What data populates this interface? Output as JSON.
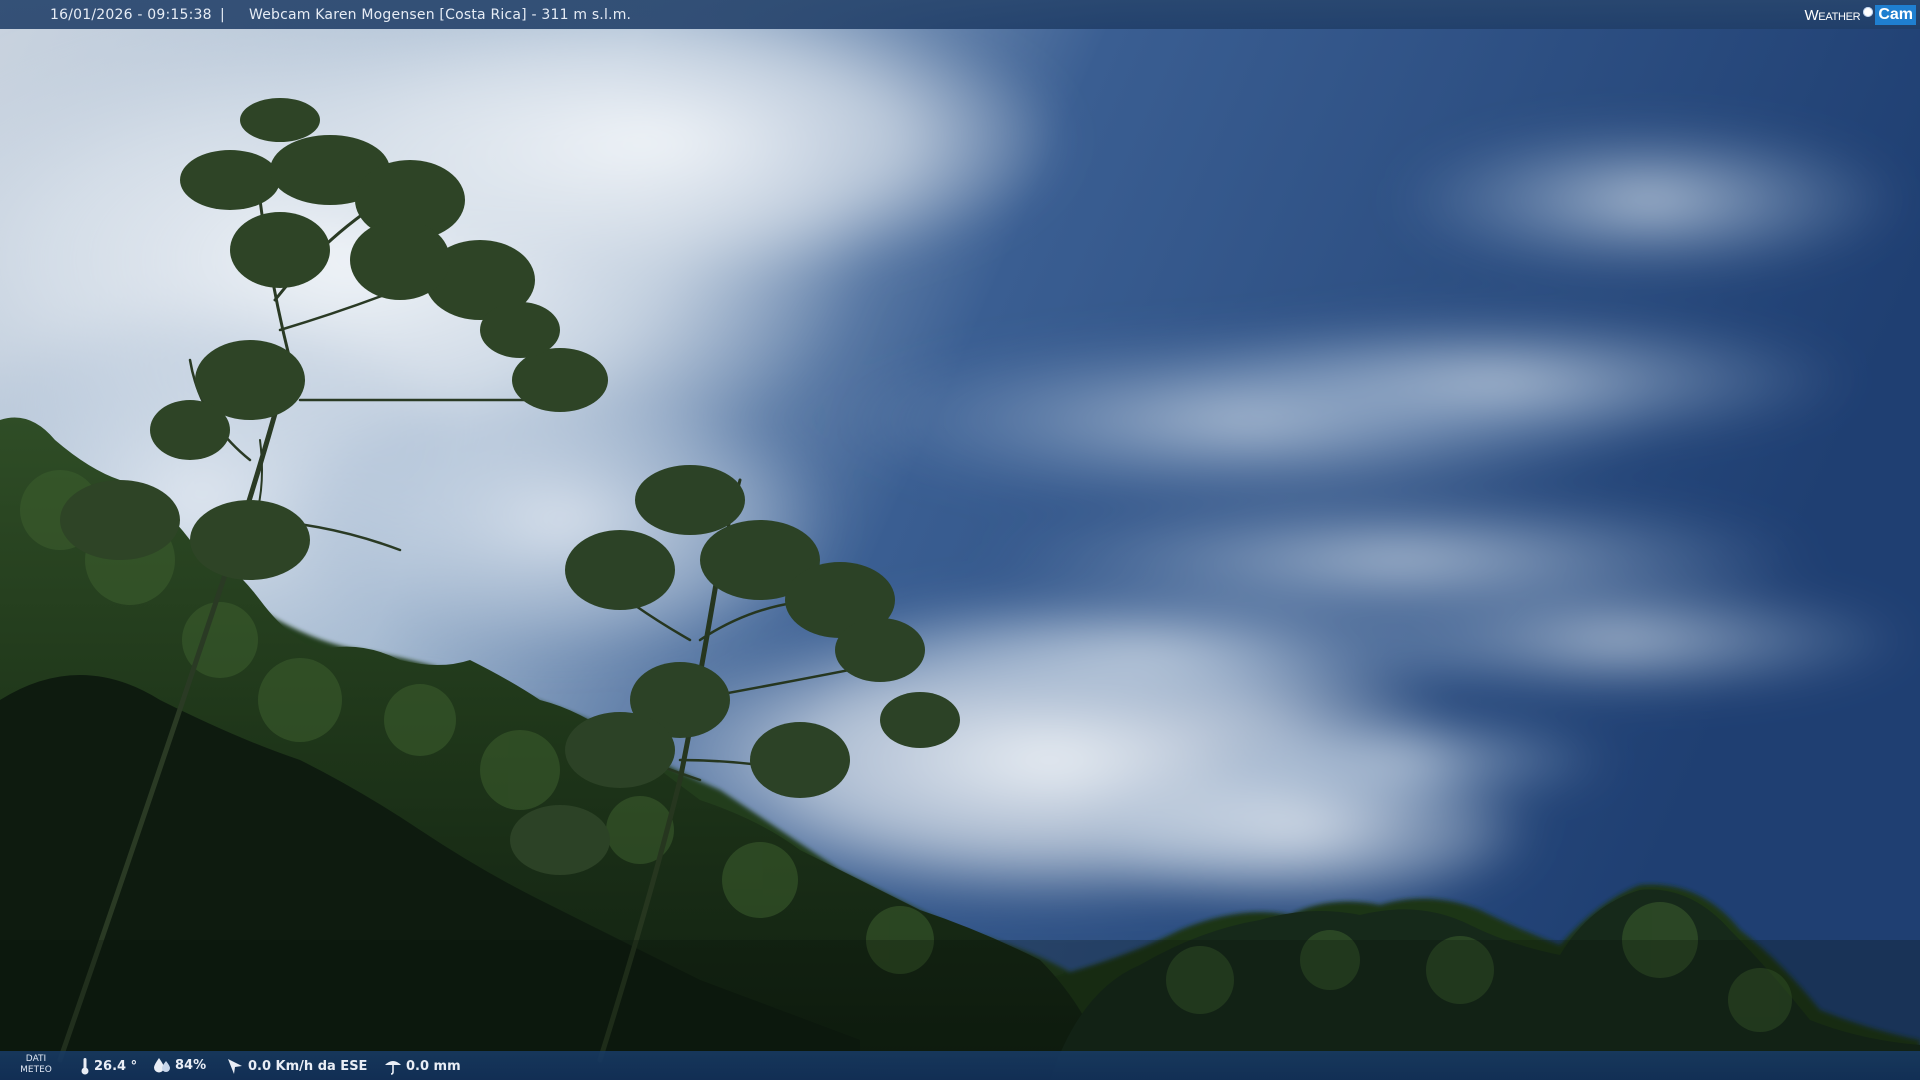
{
  "top_bar": {
    "datetime": "16/01/2026 - 09:15:38",
    "separator": "|",
    "webcam_title": "Webcam Karen Mogensen [Costa Rica]  - 311 m s.l.m."
  },
  "logo": {
    "weather_text": "Weather",
    "cam_text": "Cam"
  },
  "bottom_bar": {
    "dati_label_line1": "DATI",
    "dati_label_line2": "METEO",
    "temperature": "26.4 °",
    "humidity": "84%",
    "wind": "0.0 Km/h da ESE",
    "rain": "0.0 mm"
  },
  "icons": {
    "temperature": "thermometer-icon",
    "humidity": "water-drop-icon",
    "wind": "wind-direction-icon",
    "rain": "rain-gauge-icon"
  },
  "colors": {
    "bar_bg": "#244a78",
    "sky_deep": "#24477a",
    "sky_light": "#dfe6ee",
    "foliage_dark": "#152a14",
    "foliage_mid": "#2c4a24",
    "logo_accent": "#1f7fd0"
  }
}
